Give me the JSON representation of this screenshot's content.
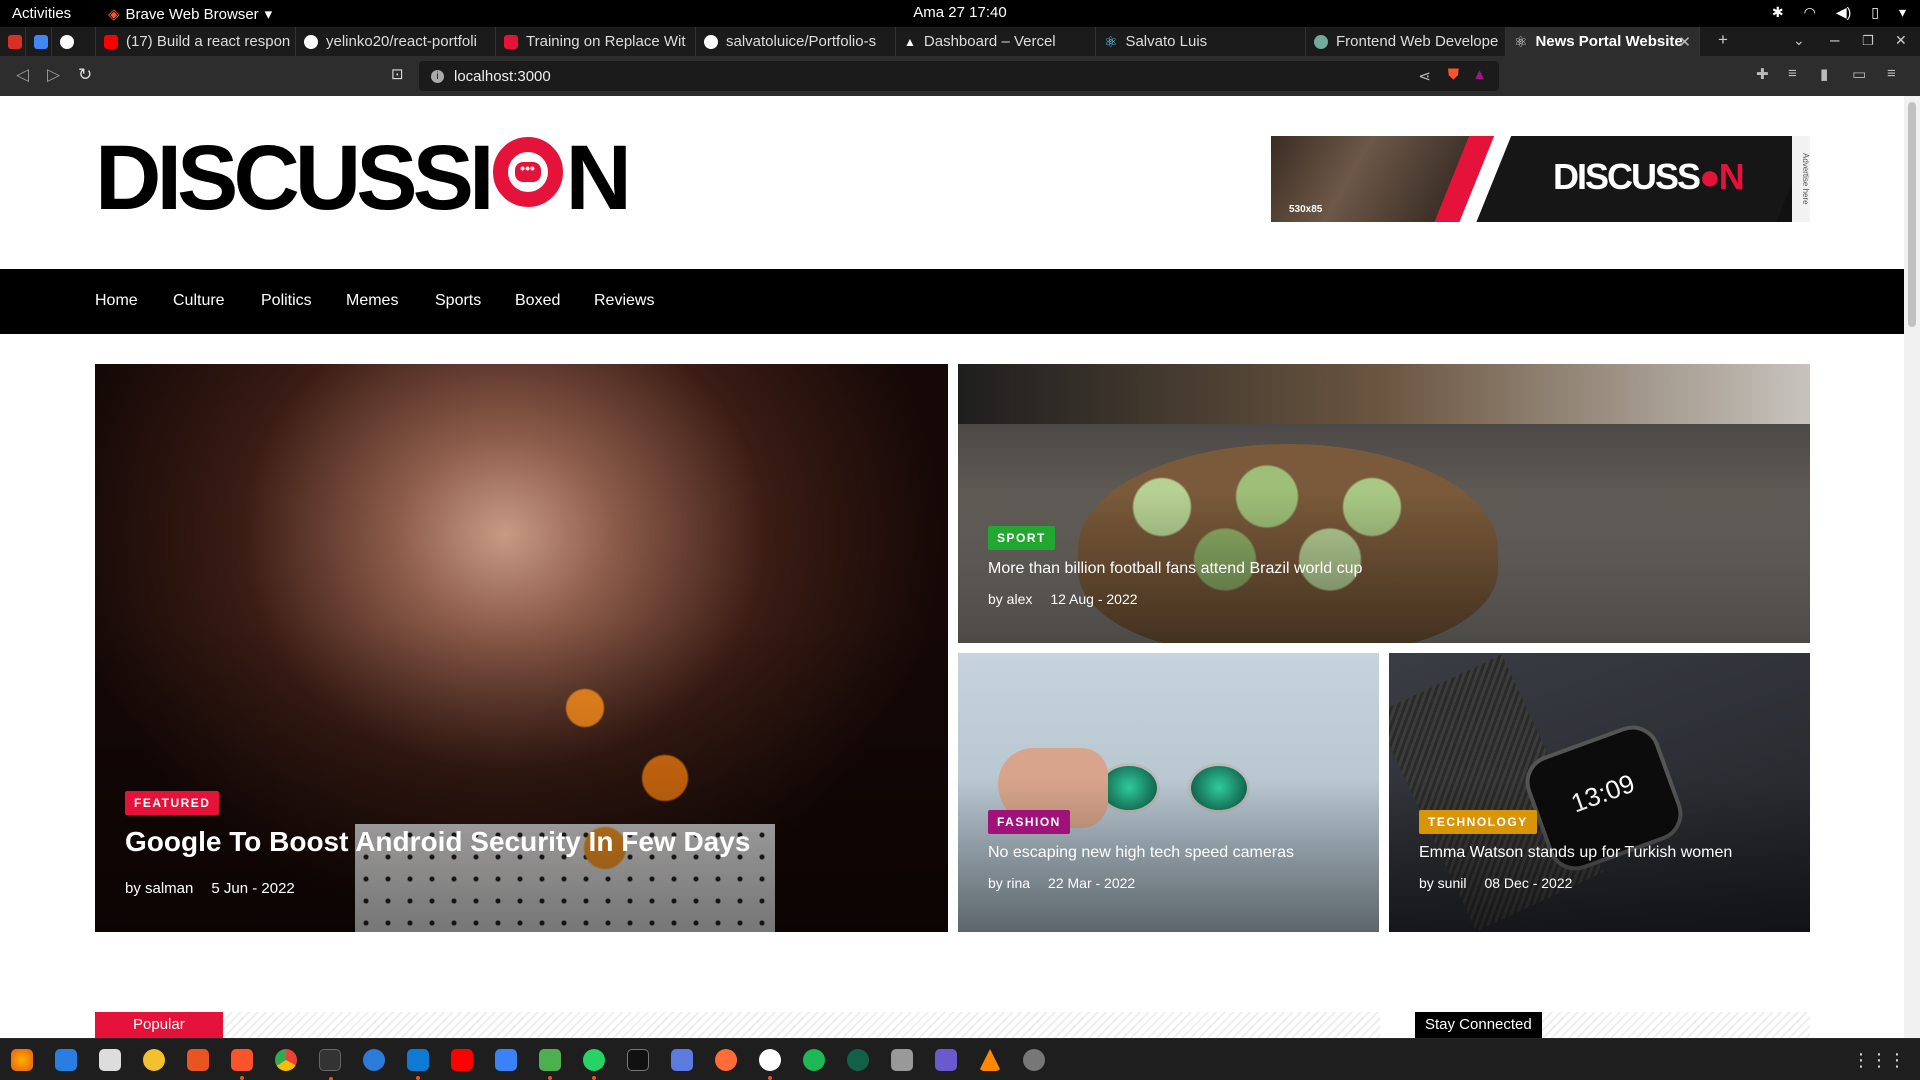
{
  "topbar": {
    "activities": "Activities",
    "app_name": "Brave Web Browser",
    "clock": "Ama 27  17:40"
  },
  "tabs": [
    {
      "title": "",
      "icon": "gmail-icon",
      "color": "#d93025"
    },
    {
      "title": "",
      "icon": "calendar-icon",
      "color": "#4285f4"
    },
    {
      "title": "",
      "icon": "medium-icon",
      "color": "#ffffff"
    },
    {
      "title": "(17) Build a react respon",
      "icon": "youtube-icon",
      "color": "#ff0000"
    },
    {
      "title": "yelinko20/react-portfoli",
      "icon": "github-icon",
      "color": "#ffffff"
    },
    {
      "title": "Training on Replace Wit",
      "icon": "training-icon",
      "color": "#e5133a"
    },
    {
      "title": "salvatoluice/Portfolio-s",
      "icon": "github-icon",
      "color": "#ffffff"
    },
    {
      "title": "Dashboard – Vercel",
      "icon": "vercel-icon",
      "color": "#ffffff"
    },
    {
      "title": "Salvato Luis",
      "icon": "react-icon",
      "color": "#61dafb"
    },
    {
      "title": "Frontend Web Develope",
      "icon": "chatgpt-icon",
      "color": "#74aa9c"
    },
    {
      "title": "News Portal Website",
      "icon": "react-icon",
      "color": "#61dafb"
    }
  ],
  "toolbar": {
    "url": "localhost:3000"
  },
  "site": {
    "logo_left": "DISCUSSI",
    "logo_right": "N",
    "logo_dots": "•••",
    "ad": {
      "brand_left": "DISCUSS",
      "brand_right": "N",
      "size": "530x85",
      "side": "Advertise here"
    },
    "nav": [
      "Home",
      "Culture",
      "Politics",
      "Memes",
      "Sports",
      "Boxed",
      "Reviews"
    ]
  },
  "hero": {
    "featured": {
      "badge": "FEATURED",
      "title": "Google To Boost Android Security In Few Days",
      "author": "by salman",
      "date": "5 Jun - 2022",
      "badge_color": "#e5133a"
    },
    "sport": {
      "badge": "SPORT",
      "title": "More than billion football fans attend Brazil world cup",
      "author": "by alex",
      "date": "12 Aug - 2022",
      "badge_color": "#22a830"
    },
    "fashion": {
      "badge": "FASHION",
      "title": "No escaping new high tech speed cameras",
      "author": "by rina",
      "date": "22 Mar - 2022",
      "badge_color": "#a0127a"
    },
    "technology": {
      "badge": "TECHNOLOGY",
      "title": "Emma Watson stands up for Turkish women",
      "author": "by sunil",
      "date": "08 Dec - 2022",
      "badge_color": "#d9950a"
    }
  },
  "sections": {
    "popular": "Popular",
    "stay_connected": "Stay Connected"
  },
  "colors": {
    "accent": "#e5133a",
    "nav_bg": "#000000"
  },
  "taskbar": [
    "firefox-icon",
    "thunderbird-icon",
    "files-icon",
    "rhythmbox-icon",
    "software-icon",
    "brave-icon",
    "chrome-icon",
    "terminal-icon",
    "help-icon",
    "vscode-icon",
    "youtube-icon",
    "document-icon",
    "picture-icon",
    "whatsapp-icon",
    "notes-icon",
    "calculator-icon",
    "postman-icon",
    "slack-icon",
    "spotify-icon",
    "mongodb-icon",
    "database-icon",
    "screenshot-icon",
    "vlc-icon",
    "update-icon"
  ]
}
